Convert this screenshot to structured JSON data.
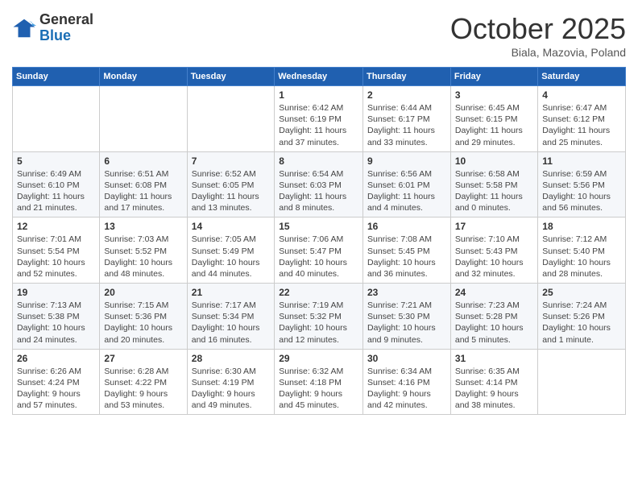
{
  "header": {
    "logo_general": "General",
    "logo_blue": "Blue",
    "month": "October 2025",
    "location": "Biala, Mazovia, Poland"
  },
  "days_of_week": [
    "Sunday",
    "Monday",
    "Tuesday",
    "Wednesday",
    "Thursday",
    "Friday",
    "Saturday"
  ],
  "weeks": [
    [
      {
        "day": "",
        "info": ""
      },
      {
        "day": "",
        "info": ""
      },
      {
        "day": "",
        "info": ""
      },
      {
        "day": "1",
        "info": "Sunrise: 6:42 AM\nSunset: 6:19 PM\nDaylight: 11 hours\nand 37 minutes."
      },
      {
        "day": "2",
        "info": "Sunrise: 6:44 AM\nSunset: 6:17 PM\nDaylight: 11 hours\nand 33 minutes."
      },
      {
        "day": "3",
        "info": "Sunrise: 6:45 AM\nSunset: 6:15 PM\nDaylight: 11 hours\nand 29 minutes."
      },
      {
        "day": "4",
        "info": "Sunrise: 6:47 AM\nSunset: 6:12 PM\nDaylight: 11 hours\nand 25 minutes."
      }
    ],
    [
      {
        "day": "5",
        "info": "Sunrise: 6:49 AM\nSunset: 6:10 PM\nDaylight: 11 hours\nand 21 minutes."
      },
      {
        "day": "6",
        "info": "Sunrise: 6:51 AM\nSunset: 6:08 PM\nDaylight: 11 hours\nand 17 minutes."
      },
      {
        "day": "7",
        "info": "Sunrise: 6:52 AM\nSunset: 6:05 PM\nDaylight: 11 hours\nand 13 minutes."
      },
      {
        "day": "8",
        "info": "Sunrise: 6:54 AM\nSunset: 6:03 PM\nDaylight: 11 hours\nand 8 minutes."
      },
      {
        "day": "9",
        "info": "Sunrise: 6:56 AM\nSunset: 6:01 PM\nDaylight: 11 hours\nand 4 minutes."
      },
      {
        "day": "10",
        "info": "Sunrise: 6:58 AM\nSunset: 5:58 PM\nDaylight: 11 hours\nand 0 minutes."
      },
      {
        "day": "11",
        "info": "Sunrise: 6:59 AM\nSunset: 5:56 PM\nDaylight: 10 hours\nand 56 minutes."
      }
    ],
    [
      {
        "day": "12",
        "info": "Sunrise: 7:01 AM\nSunset: 5:54 PM\nDaylight: 10 hours\nand 52 minutes."
      },
      {
        "day": "13",
        "info": "Sunrise: 7:03 AM\nSunset: 5:52 PM\nDaylight: 10 hours\nand 48 minutes."
      },
      {
        "day": "14",
        "info": "Sunrise: 7:05 AM\nSunset: 5:49 PM\nDaylight: 10 hours\nand 44 minutes."
      },
      {
        "day": "15",
        "info": "Sunrise: 7:06 AM\nSunset: 5:47 PM\nDaylight: 10 hours\nand 40 minutes."
      },
      {
        "day": "16",
        "info": "Sunrise: 7:08 AM\nSunset: 5:45 PM\nDaylight: 10 hours\nand 36 minutes."
      },
      {
        "day": "17",
        "info": "Sunrise: 7:10 AM\nSunset: 5:43 PM\nDaylight: 10 hours\nand 32 minutes."
      },
      {
        "day": "18",
        "info": "Sunrise: 7:12 AM\nSunset: 5:40 PM\nDaylight: 10 hours\nand 28 minutes."
      }
    ],
    [
      {
        "day": "19",
        "info": "Sunrise: 7:13 AM\nSunset: 5:38 PM\nDaylight: 10 hours\nand 24 minutes."
      },
      {
        "day": "20",
        "info": "Sunrise: 7:15 AM\nSunset: 5:36 PM\nDaylight: 10 hours\nand 20 minutes."
      },
      {
        "day": "21",
        "info": "Sunrise: 7:17 AM\nSunset: 5:34 PM\nDaylight: 10 hours\nand 16 minutes."
      },
      {
        "day": "22",
        "info": "Sunrise: 7:19 AM\nSunset: 5:32 PM\nDaylight: 10 hours\nand 12 minutes."
      },
      {
        "day": "23",
        "info": "Sunrise: 7:21 AM\nSunset: 5:30 PM\nDaylight: 10 hours\nand 9 minutes."
      },
      {
        "day": "24",
        "info": "Sunrise: 7:23 AM\nSunset: 5:28 PM\nDaylight: 10 hours\nand 5 minutes."
      },
      {
        "day": "25",
        "info": "Sunrise: 7:24 AM\nSunset: 5:26 PM\nDaylight: 10 hours\nand 1 minute."
      }
    ],
    [
      {
        "day": "26",
        "info": "Sunrise: 6:26 AM\nSunset: 4:24 PM\nDaylight: 9 hours\nand 57 minutes."
      },
      {
        "day": "27",
        "info": "Sunrise: 6:28 AM\nSunset: 4:22 PM\nDaylight: 9 hours\nand 53 minutes."
      },
      {
        "day": "28",
        "info": "Sunrise: 6:30 AM\nSunset: 4:19 PM\nDaylight: 9 hours\nand 49 minutes."
      },
      {
        "day": "29",
        "info": "Sunrise: 6:32 AM\nSunset: 4:18 PM\nDaylight: 9 hours\nand 45 minutes."
      },
      {
        "day": "30",
        "info": "Sunrise: 6:34 AM\nSunset: 4:16 PM\nDaylight: 9 hours\nand 42 minutes."
      },
      {
        "day": "31",
        "info": "Sunrise: 6:35 AM\nSunset: 4:14 PM\nDaylight: 9 hours\nand 38 minutes."
      },
      {
        "day": "",
        "info": ""
      }
    ]
  ]
}
